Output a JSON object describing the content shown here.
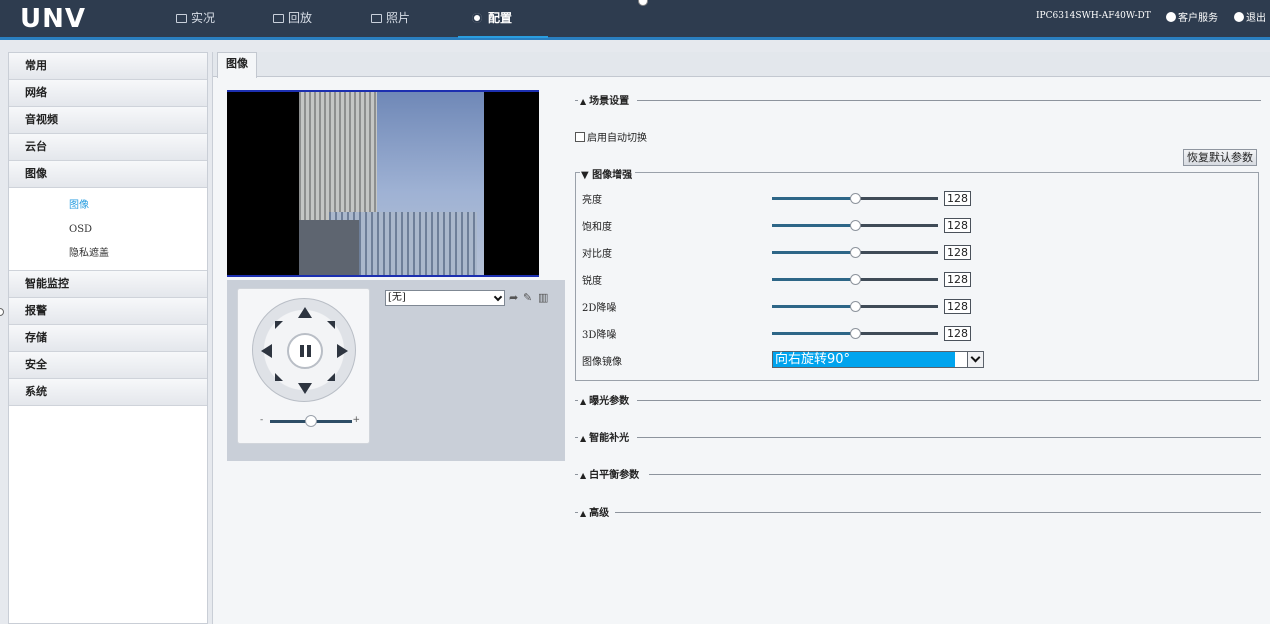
{
  "header": {
    "logo": "UNV",
    "nav": [
      {
        "label": "实况",
        "icon": "monitor-icon"
      },
      {
        "label": "回放",
        "icon": "playback-icon"
      },
      {
        "label": "照片",
        "icon": "photo-icon"
      },
      {
        "label": "配置",
        "icon": "gear-icon",
        "active": true
      }
    ],
    "model": "IPC6314SWH-AF40W-DT",
    "customer_service": "客户服务",
    "logout": "退出",
    "accent": "#2a9ee0"
  },
  "sidebar": {
    "items": [
      {
        "label": "常用"
      },
      {
        "label": "网络"
      },
      {
        "label": "音视频"
      },
      {
        "label": "云台"
      },
      {
        "label": "图像"
      },
      {
        "label": "智能监控"
      },
      {
        "label": "报警"
      },
      {
        "label": "存储"
      },
      {
        "label": "安全"
      },
      {
        "label": "系统"
      }
    ],
    "submenu": [
      {
        "label": "图像",
        "active": true
      },
      {
        "label": "OSD"
      },
      {
        "label": "隐私遮盖"
      }
    ]
  },
  "tabs": [
    {
      "label": "图像"
    }
  ],
  "ptz": {
    "preset_value": "[无]",
    "zoom_minus": "-",
    "zoom_plus": "+",
    "zoom_level": 0.5
  },
  "settings": {
    "scene_title": "场景设置",
    "auto_switch_label": "启用自动切换",
    "auto_switch_checked": false,
    "restore_button": "恢复默认参数",
    "enhance_title": "图像增强",
    "params": [
      {
        "label": "亮度",
        "value": "128",
        "level": 0.5
      },
      {
        "label": "饱和度",
        "value": "128",
        "level": 0.5
      },
      {
        "label": "对比度",
        "value": "128",
        "level": 0.5
      },
      {
        "label": "锐度",
        "value": "128",
        "level": 0.5
      },
      {
        "label": "2D降噪",
        "value": "128",
        "level": 0.5
      },
      {
        "label": "3D降噪",
        "value": "128",
        "level": 0.5
      }
    ],
    "mirror_label": "图像镜像",
    "mirror_value": "向右旋转90°",
    "sections": [
      "曝光参数",
      "智能补光",
      "白平衡参数",
      "高级"
    ]
  }
}
